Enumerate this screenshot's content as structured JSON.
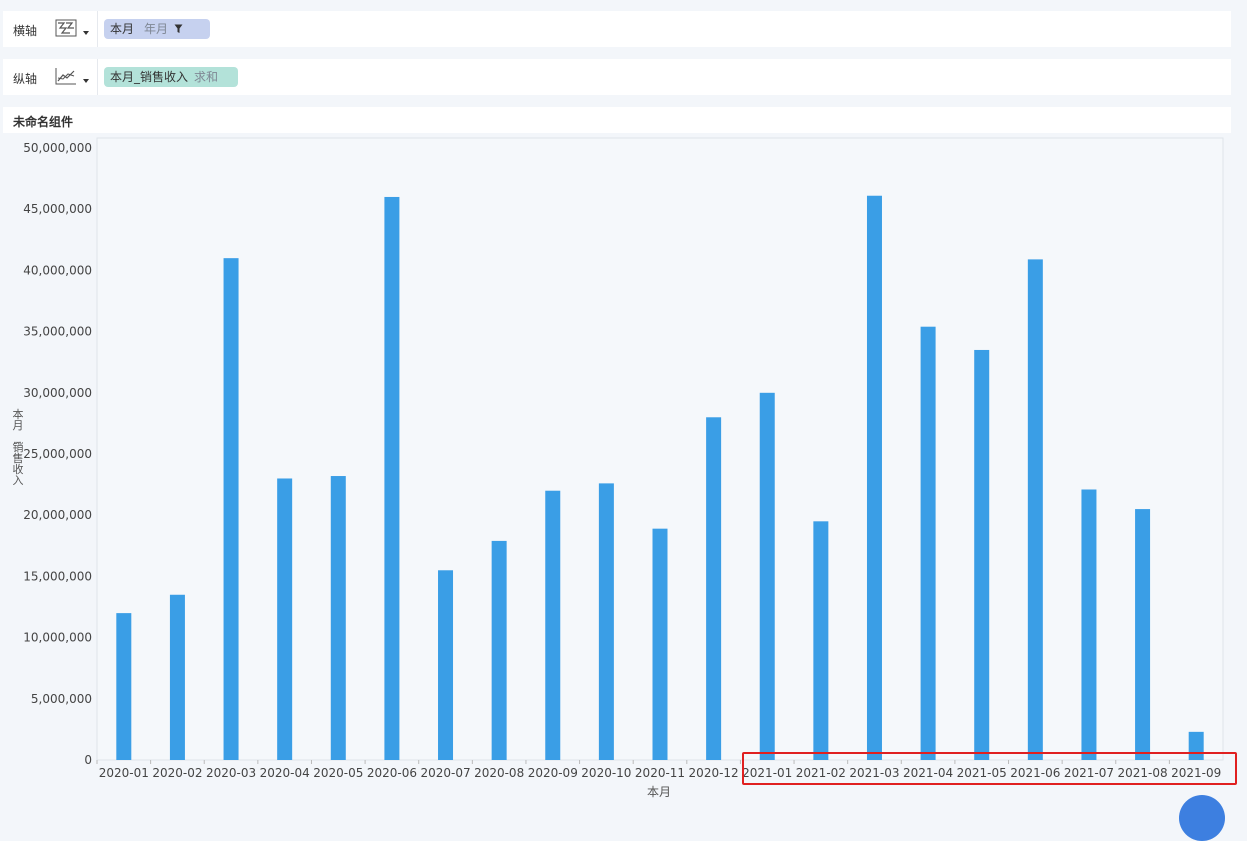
{
  "x_axis_row": {
    "label": "横轴",
    "type_icon": "chart-type-icon",
    "field": "本月",
    "modifier": "年月",
    "filter_icon": "filter-icon"
  },
  "y_axis_row": {
    "label": "纵轴",
    "type_icon": "line-chart-type-icon",
    "field": "本月_销售收入",
    "modifier": "求和"
  },
  "component": {
    "title": "未命名组件"
  },
  "colors": {
    "bar": "#3a9ee6",
    "x_pill": "#c6d1ef",
    "y_pill": "#b3e2d9",
    "highlight": "#e02020"
  },
  "chart_data": {
    "type": "bar",
    "xlabel": "本月",
    "ylabel": "本月_销售收入",
    "ylim": [
      0,
      50000000
    ],
    "yticks": [
      "0",
      "5,000,000",
      "10,000,000",
      "15,000,000",
      "20,000,000",
      "25,000,000",
      "30,000,000",
      "35,000,000",
      "40,000,000",
      "45,000,000",
      "50,000,000"
    ],
    "categories": [
      "2020-01",
      "2020-02",
      "2020-03",
      "2020-04",
      "2020-05",
      "2020-06",
      "2020-07",
      "2020-08",
      "2020-09",
      "2020-10",
      "2020-11",
      "2020-12",
      "2021-01",
      "2021-02",
      "2021-03",
      "2021-04",
      "2021-05",
      "2021-06",
      "2021-07",
      "2021-08",
      "2021-09"
    ],
    "values": [
      12000000,
      13500000,
      41000000,
      23000000,
      23200000,
      46000000,
      15500000,
      17900000,
      22000000,
      22600000,
      18900000,
      28000000,
      30000000,
      19500000,
      46100000,
      35400000,
      33500000,
      40900000,
      22100000,
      20500000,
      2300000
    ],
    "grid": false,
    "legend": "none"
  }
}
